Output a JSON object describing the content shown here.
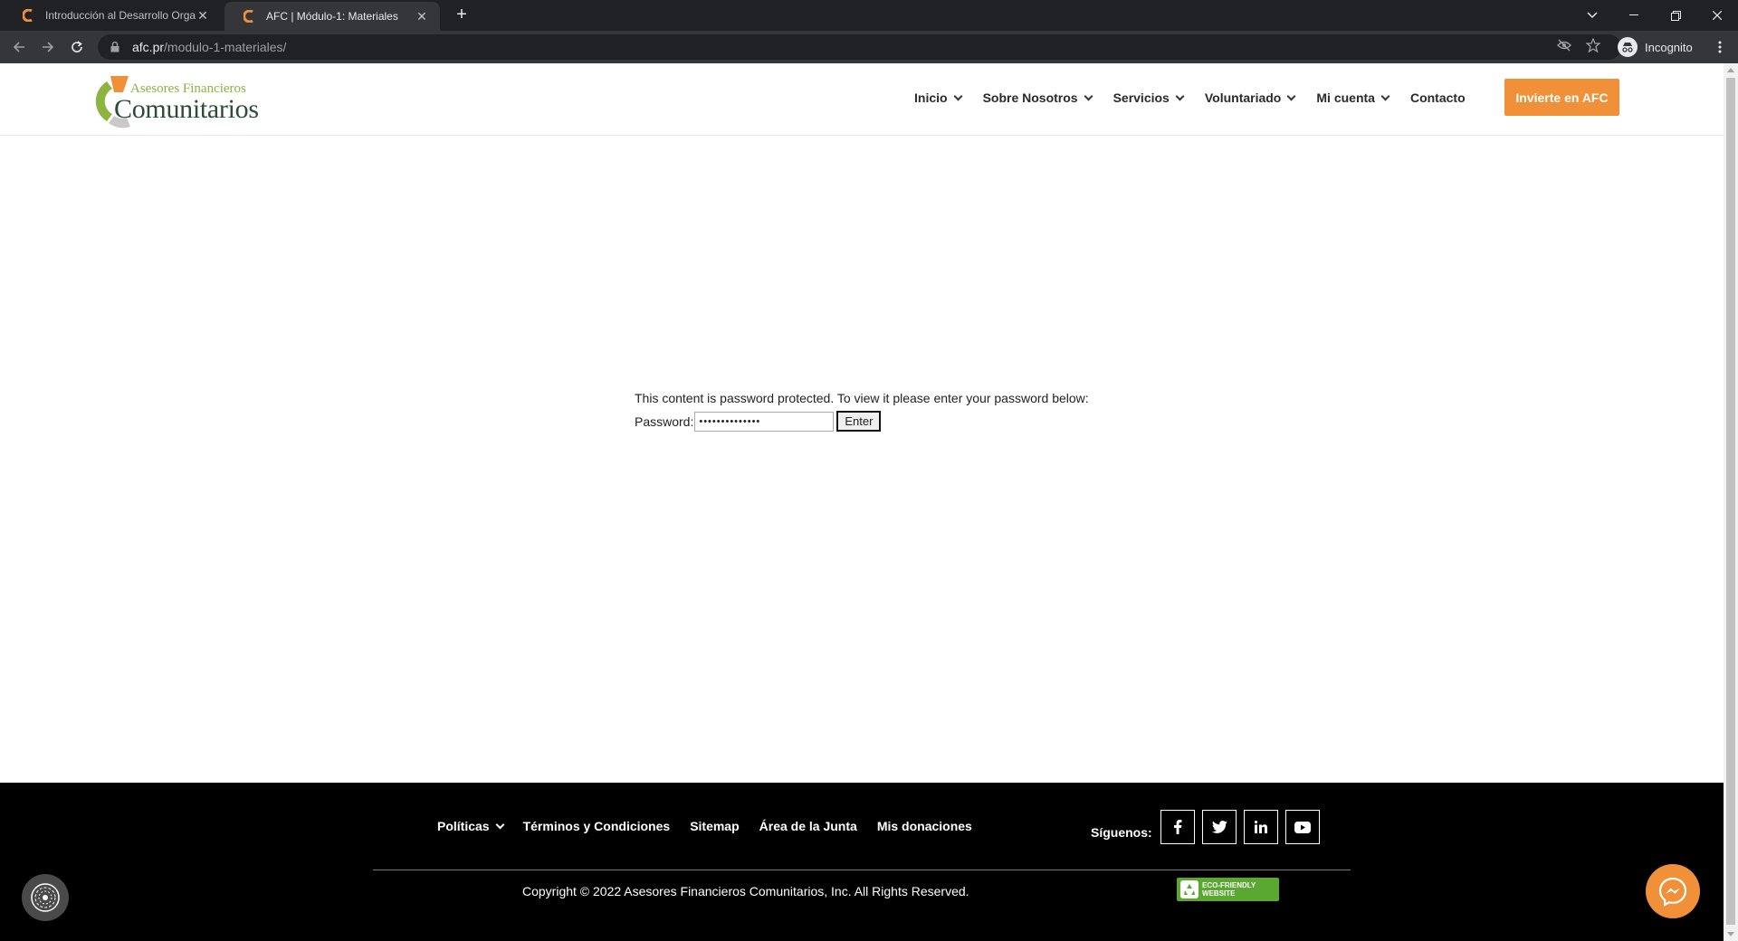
{
  "browser": {
    "tabs": [
      {
        "title": "Introducción al Desarrollo Organizacional",
        "active": false
      },
      {
        "title": "AFC | Módulo-1: Materiales",
        "active": true
      }
    ],
    "url_host": "afc.pr",
    "url_path": "/modulo-1-materiales/",
    "profile_label": "Incognito"
  },
  "header": {
    "logo_line1": "Asesores Financieros",
    "logo_line2": "Comunitarios",
    "nav": [
      {
        "label": "Inicio",
        "dropdown": true
      },
      {
        "label": "Sobre Nosotros",
        "dropdown": true
      },
      {
        "label": "Servicios",
        "dropdown": true
      },
      {
        "label": "Voluntariado",
        "dropdown": true
      },
      {
        "label": "Mi cuenta",
        "dropdown": true
      },
      {
        "label": "Contacto",
        "dropdown": false
      }
    ],
    "cta_label": "Invierte en AFC"
  },
  "protected": {
    "message": "This content is password protected. To view it please enter your password below:",
    "label": "Password:",
    "value_masked": "••••••••••••••",
    "button": "Enter"
  },
  "footer": {
    "nav": [
      {
        "label": "Políticas",
        "dropdown": true
      },
      {
        "label": "Términos y Condiciones",
        "dropdown": false
      },
      {
        "label": "Sitemap",
        "dropdown": false
      },
      {
        "label": "Área de la Junta",
        "dropdown": false
      },
      {
        "label": "Mis donaciones",
        "dropdown": false
      }
    ],
    "follow_label": "Síguenos:",
    "social": [
      "facebook-icon",
      "twitter-icon",
      "linkedin-icon",
      "youtube-icon"
    ],
    "copyright": "Copyright © 2022 Asesores Financieros Comunitarios, Inc. All Rights Reserved.",
    "eco_badge_line1": "ECO-FRIENDLY",
    "eco_badge_line2": "WEBSITE"
  },
  "colors": {
    "accent": "#f0913a",
    "logo_green": "#8cb43f",
    "logo_dark": "#2e4b3a",
    "footer_bg": "#000000"
  }
}
